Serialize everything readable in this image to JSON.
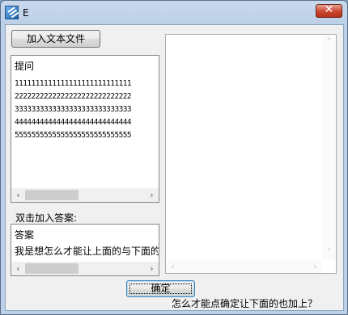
{
  "window": {
    "title": "E",
    "close_glyph": "✕",
    "app_icon": "form-app-icon"
  },
  "toolbar": {
    "add_file_label": "加入文本文件"
  },
  "question_panel": {
    "title": "提问",
    "lines": [
      "1111111111111111111111111111",
      "2222222222222222222222222222",
      "3333333333333333333333333333",
      "4444444444444444444444444444",
      "5555555555555555555555555555"
    ]
  },
  "answer_section": {
    "label": "双击加入答案:",
    "title": "答案",
    "text": "我是想怎么才能让上面的与下面的"
  },
  "buttons": {
    "ok_label": "确定"
  },
  "note": "怎么才能点确定让下面的也加上？",
  "scroll_glyphs": {
    "left": "‹",
    "right": "›",
    "up": "˄",
    "down": "˅"
  }
}
